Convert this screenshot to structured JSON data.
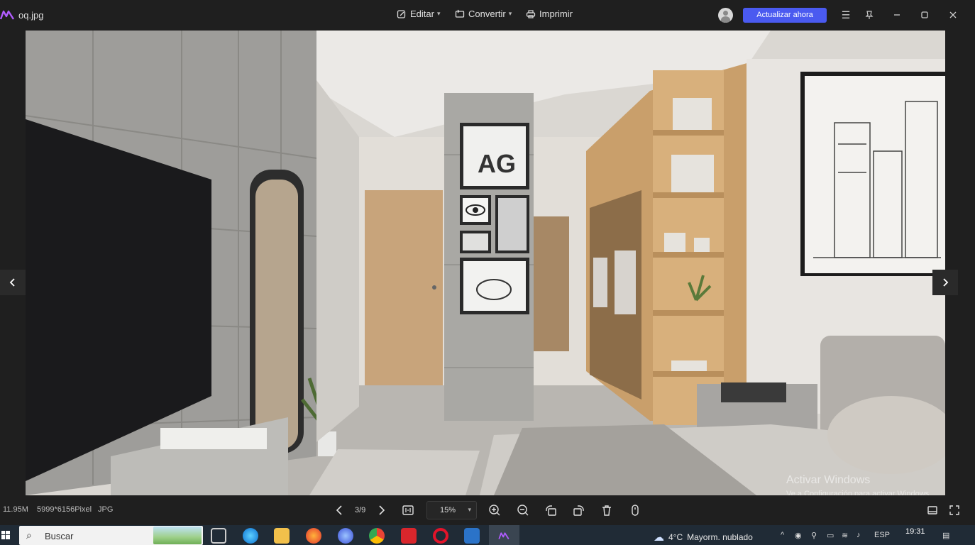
{
  "titlebar": {
    "filename": "oq.jpg",
    "menus": [
      {
        "label": "Editar",
        "icon": "edit-icon"
      },
      {
        "label": "Convertir",
        "icon": "convert-icon"
      },
      {
        "label": "Imprimir",
        "icon": "print-icon"
      }
    ],
    "update_button": "Actualizar ahora",
    "accent_color": "#4a5af0"
  },
  "viewer": {
    "watermark_title": "Activar Windows",
    "watermark_subtitle": "Ve a Configuración para activar Windows."
  },
  "bottombar": {
    "file_size": "11.95M",
    "dimensions": "5999*6156Pixel",
    "format": "JPG",
    "page": "3/9",
    "zoom": "15%"
  },
  "taskbar": {
    "search_placeholder": "Buscar",
    "weather_temp": "4°C",
    "weather_text": "Mayorm. nublado",
    "language": "ESP",
    "time": "19:31"
  }
}
